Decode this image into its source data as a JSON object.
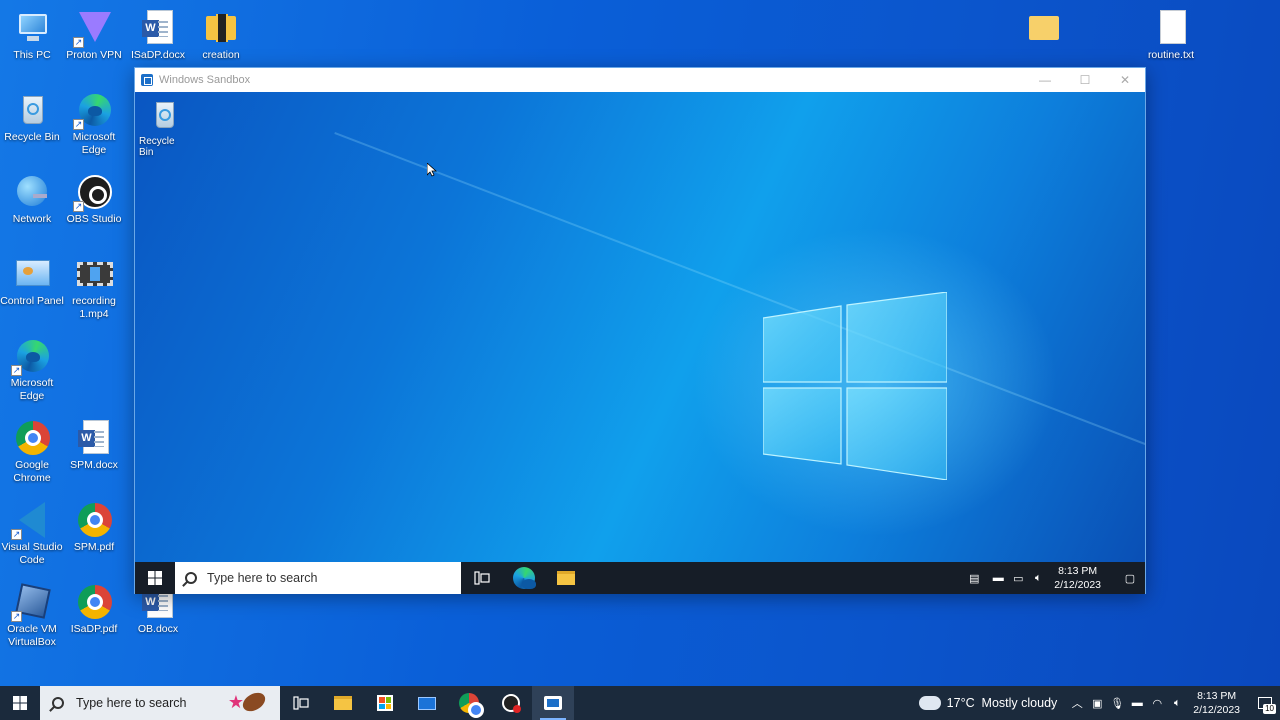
{
  "desktop_icons": [
    {
      "name": "this-pc",
      "label": "This PC"
    },
    {
      "name": "proton-vpn",
      "label": "Proton VPN"
    },
    {
      "name": "isadp-docx",
      "label": "ISaDP.docx"
    },
    {
      "name": "creation",
      "label": "creation"
    },
    {
      "name": "recycle-bin",
      "label": "Recycle Bin"
    },
    {
      "name": "microsoft-edge-1",
      "label": "Microsoft\nEdge"
    },
    {
      "name": "network",
      "label": "Network"
    },
    {
      "name": "obs-studio",
      "label": "OBS Studio"
    },
    {
      "name": "control-panel",
      "label": "Control Panel"
    },
    {
      "name": "recording-mp4",
      "label": "recording\n1.mp4"
    },
    {
      "name": "microsoft-edge-2",
      "label": "Microsoft\nEdge"
    },
    {
      "name": "google-chrome",
      "label": "Google\nChrome"
    },
    {
      "name": "spm-docx",
      "label": "SPM.docx"
    },
    {
      "name": "visual-studio-code",
      "label": "Visual Studio\nCode"
    },
    {
      "name": "spm-pdf",
      "label": "SPM.pdf"
    },
    {
      "name": "oracle-vm-virtualbox",
      "label": "Oracle VM\nVirtualBox"
    },
    {
      "name": "isadp-pdf",
      "label": "ISaDP.pdf"
    },
    {
      "name": "ob-docx",
      "label": "OB.docx"
    },
    {
      "name": "folder-unnamed",
      "label": ""
    },
    {
      "name": "routine-txt",
      "label": "routine.txt"
    }
  ],
  "sandbox": {
    "title": "Windows Sandbox",
    "desktop_icon_label": "Recycle Bin",
    "search_placeholder": "Type here to search",
    "clock_time": "8:13 PM",
    "clock_date": "2/12/2023"
  },
  "taskbar": {
    "search_placeholder": "Type here to search",
    "weather_text": "17°C  Mostly cloudy",
    "clock_time": "8:13 PM",
    "clock_date": "2/12/2023",
    "notification_count": "10"
  },
  "colors": {
    "accent": "#0a5fd8",
    "taskbar": "#1b2a3c",
    "sandbox_taskbar": "#161d27"
  }
}
